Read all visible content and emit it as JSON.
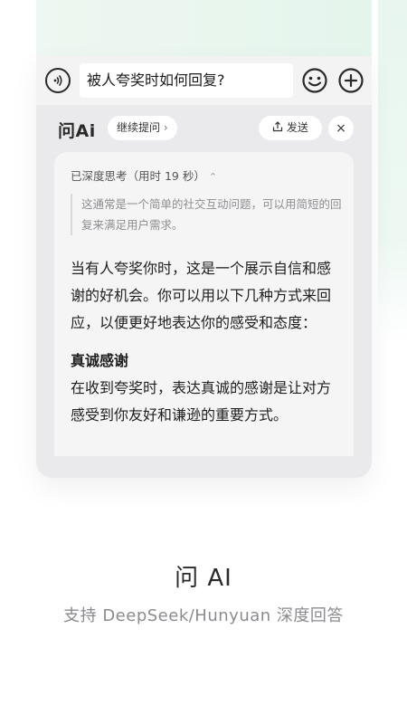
{
  "input": {
    "query": "被人夸奖时如何回复?"
  },
  "ai_panel": {
    "logo": "问Ai",
    "continue_label": "继续提问",
    "send_label": "发送",
    "close_label": "×"
  },
  "thinking": {
    "status": "已深度思考（用时 19 秒）",
    "text": "这通常是一个简单的社交互动问题，可以用简短的回复来满足用户需求。"
  },
  "answer": {
    "intro": "当有人夸奖你时，这是一个展示自信和感谢的好机会。你可以用以下几种方式来回应，以便更好地表达你的感受和态度：",
    "section_heading": "真诚感谢",
    "section_text": "在收到夸奖时，表达真诚的感谢是让对方感受到你友好和谦逊的重要方式。"
  },
  "feature": {
    "title": "问 AI",
    "subtitle": "支持 DeepSeek/Hunyuan 深度回答"
  },
  "colors": {
    "accent_green": "#e4f5ec",
    "card_bg": "#eaeaec",
    "answer_bg": "#f5f5f6"
  },
  "icons": [
    "voice-icon",
    "emoji-icon",
    "plus-icon",
    "chevron-right-icon",
    "share-icon",
    "close-icon",
    "chevron-up-icon"
  ]
}
